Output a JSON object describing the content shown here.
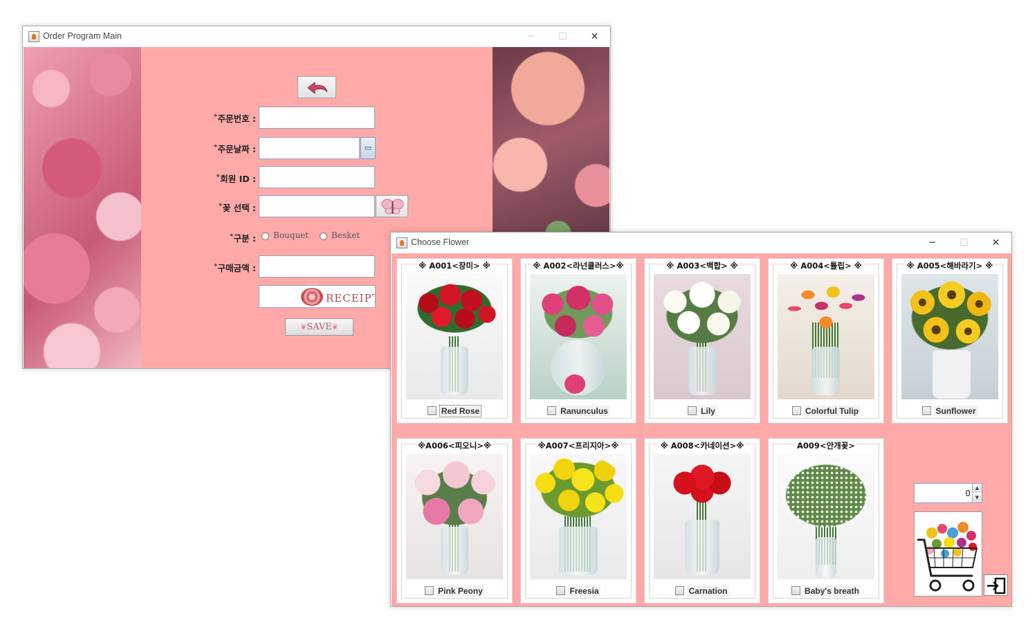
{
  "main_window": {
    "title": "Order Program Main",
    "labels": {
      "order_no": "˚주문번호 :",
      "order_date": "˚주문날짜 :",
      "member_id": "˚회원 ID :",
      "flower_select": "˚꽃 선택 :",
      "category": "˚구분 :",
      "amount": "˚구매금액 :"
    },
    "fields": {
      "order_no": "",
      "order_date": "",
      "member_id": "",
      "flower_select": "",
      "amount": ""
    },
    "radio_options": [
      "Bouquet",
      "Besket"
    ],
    "receipt_label": "RECEIPT",
    "save_label": "SAVE"
  },
  "flower_window": {
    "title": "Choose Flower",
    "flowers": [
      {
        "code": "※ A001<장미> ※",
        "name": "Red Rose",
        "icon": "red-rose-image",
        "color": "#c8101e"
      },
      {
        "code": "※ A002<라넌큘러스>※",
        "name": "Ranunculus",
        "icon": "ranunculus-image",
        "color": "#d83a74"
      },
      {
        "code": "※ A003<백합> ※",
        "name": "Lily",
        "icon": "lily-image",
        "color": "#f2f2ea"
      },
      {
        "code": "※ A004<튤립> ※",
        "name": "Colorful Tulip",
        "icon": "tulip-image",
        "color": "#e8466a"
      },
      {
        "code": "※ A005<해바라기> ※",
        "name": "Sunflower",
        "icon": "sunflower-image",
        "color": "#f2c21a"
      },
      {
        "code": "※A006<피오니>※",
        "name": "Pink Peony",
        "icon": "peony-image",
        "color": "#f0a6bd"
      },
      {
        "code": "※A007<프리지아>※",
        "name": "Freesia",
        "icon": "freesia-image",
        "color": "#f5de12"
      },
      {
        "code": "※ A008<카네이션>※",
        "name": "Carnation",
        "icon": "carnation-image",
        "color": "#d4101c"
      },
      {
        "code": "A009<안개꽃>",
        "name": "Baby's breath",
        "icon": "babys-breath-image",
        "color": "#f7f7f2"
      }
    ],
    "quantity": "0"
  }
}
